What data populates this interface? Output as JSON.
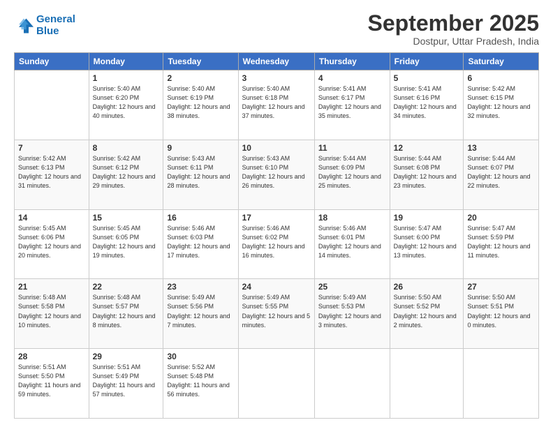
{
  "header": {
    "logo_line1": "General",
    "logo_line2": "Blue",
    "month_title": "September 2025",
    "location": "Dostpur, Uttar Pradesh, India"
  },
  "days_of_week": [
    "Sunday",
    "Monday",
    "Tuesday",
    "Wednesday",
    "Thursday",
    "Friday",
    "Saturday"
  ],
  "weeks": [
    [
      {
        "day": "",
        "sunrise": "",
        "sunset": "",
        "daylight": ""
      },
      {
        "day": "1",
        "sunrise": "Sunrise: 5:40 AM",
        "sunset": "Sunset: 6:20 PM",
        "daylight": "Daylight: 12 hours and 40 minutes."
      },
      {
        "day": "2",
        "sunrise": "Sunrise: 5:40 AM",
        "sunset": "Sunset: 6:19 PM",
        "daylight": "Daylight: 12 hours and 38 minutes."
      },
      {
        "day": "3",
        "sunrise": "Sunrise: 5:40 AM",
        "sunset": "Sunset: 6:18 PM",
        "daylight": "Daylight: 12 hours and 37 minutes."
      },
      {
        "day": "4",
        "sunrise": "Sunrise: 5:41 AM",
        "sunset": "Sunset: 6:17 PM",
        "daylight": "Daylight: 12 hours and 35 minutes."
      },
      {
        "day": "5",
        "sunrise": "Sunrise: 5:41 AM",
        "sunset": "Sunset: 6:16 PM",
        "daylight": "Daylight: 12 hours and 34 minutes."
      },
      {
        "day": "6",
        "sunrise": "Sunrise: 5:42 AM",
        "sunset": "Sunset: 6:15 PM",
        "daylight": "Daylight: 12 hours and 32 minutes."
      }
    ],
    [
      {
        "day": "7",
        "sunrise": "Sunrise: 5:42 AM",
        "sunset": "Sunset: 6:13 PM",
        "daylight": "Daylight: 12 hours and 31 minutes."
      },
      {
        "day": "8",
        "sunrise": "Sunrise: 5:42 AM",
        "sunset": "Sunset: 6:12 PM",
        "daylight": "Daylight: 12 hours and 29 minutes."
      },
      {
        "day": "9",
        "sunrise": "Sunrise: 5:43 AM",
        "sunset": "Sunset: 6:11 PM",
        "daylight": "Daylight: 12 hours and 28 minutes."
      },
      {
        "day": "10",
        "sunrise": "Sunrise: 5:43 AM",
        "sunset": "Sunset: 6:10 PM",
        "daylight": "Daylight: 12 hours and 26 minutes."
      },
      {
        "day": "11",
        "sunrise": "Sunrise: 5:44 AM",
        "sunset": "Sunset: 6:09 PM",
        "daylight": "Daylight: 12 hours and 25 minutes."
      },
      {
        "day": "12",
        "sunrise": "Sunrise: 5:44 AM",
        "sunset": "Sunset: 6:08 PM",
        "daylight": "Daylight: 12 hours and 23 minutes."
      },
      {
        "day": "13",
        "sunrise": "Sunrise: 5:44 AM",
        "sunset": "Sunset: 6:07 PM",
        "daylight": "Daylight: 12 hours and 22 minutes."
      }
    ],
    [
      {
        "day": "14",
        "sunrise": "Sunrise: 5:45 AM",
        "sunset": "Sunset: 6:06 PM",
        "daylight": "Daylight: 12 hours and 20 minutes."
      },
      {
        "day": "15",
        "sunrise": "Sunrise: 5:45 AM",
        "sunset": "Sunset: 6:05 PM",
        "daylight": "Daylight: 12 hours and 19 minutes."
      },
      {
        "day": "16",
        "sunrise": "Sunrise: 5:46 AM",
        "sunset": "Sunset: 6:03 PM",
        "daylight": "Daylight: 12 hours and 17 minutes."
      },
      {
        "day": "17",
        "sunrise": "Sunrise: 5:46 AM",
        "sunset": "Sunset: 6:02 PM",
        "daylight": "Daylight: 12 hours and 16 minutes."
      },
      {
        "day": "18",
        "sunrise": "Sunrise: 5:46 AM",
        "sunset": "Sunset: 6:01 PM",
        "daylight": "Daylight: 12 hours and 14 minutes."
      },
      {
        "day": "19",
        "sunrise": "Sunrise: 5:47 AM",
        "sunset": "Sunset: 6:00 PM",
        "daylight": "Daylight: 12 hours and 13 minutes."
      },
      {
        "day": "20",
        "sunrise": "Sunrise: 5:47 AM",
        "sunset": "Sunset: 5:59 PM",
        "daylight": "Daylight: 12 hours and 11 minutes."
      }
    ],
    [
      {
        "day": "21",
        "sunrise": "Sunrise: 5:48 AM",
        "sunset": "Sunset: 5:58 PM",
        "daylight": "Daylight: 12 hours and 10 minutes."
      },
      {
        "day": "22",
        "sunrise": "Sunrise: 5:48 AM",
        "sunset": "Sunset: 5:57 PM",
        "daylight": "Daylight: 12 hours and 8 minutes."
      },
      {
        "day": "23",
        "sunrise": "Sunrise: 5:49 AM",
        "sunset": "Sunset: 5:56 PM",
        "daylight": "Daylight: 12 hours and 7 minutes."
      },
      {
        "day": "24",
        "sunrise": "Sunrise: 5:49 AM",
        "sunset": "Sunset: 5:55 PM",
        "daylight": "Daylight: 12 hours and 5 minutes."
      },
      {
        "day": "25",
        "sunrise": "Sunrise: 5:49 AM",
        "sunset": "Sunset: 5:53 PM",
        "daylight": "Daylight: 12 hours and 3 minutes."
      },
      {
        "day": "26",
        "sunrise": "Sunrise: 5:50 AM",
        "sunset": "Sunset: 5:52 PM",
        "daylight": "Daylight: 12 hours and 2 minutes."
      },
      {
        "day": "27",
        "sunrise": "Sunrise: 5:50 AM",
        "sunset": "Sunset: 5:51 PM",
        "daylight": "Daylight: 12 hours and 0 minutes."
      }
    ],
    [
      {
        "day": "28",
        "sunrise": "Sunrise: 5:51 AM",
        "sunset": "Sunset: 5:50 PM",
        "daylight": "Daylight: 11 hours and 59 minutes."
      },
      {
        "day": "29",
        "sunrise": "Sunrise: 5:51 AM",
        "sunset": "Sunset: 5:49 PM",
        "daylight": "Daylight: 11 hours and 57 minutes."
      },
      {
        "day": "30",
        "sunrise": "Sunrise: 5:52 AM",
        "sunset": "Sunset: 5:48 PM",
        "daylight": "Daylight: 11 hours and 56 minutes."
      },
      {
        "day": "",
        "sunrise": "",
        "sunset": "",
        "daylight": ""
      },
      {
        "day": "",
        "sunrise": "",
        "sunset": "",
        "daylight": ""
      },
      {
        "day": "",
        "sunrise": "",
        "sunset": "",
        "daylight": ""
      },
      {
        "day": "",
        "sunrise": "",
        "sunset": "",
        "daylight": ""
      }
    ]
  ]
}
